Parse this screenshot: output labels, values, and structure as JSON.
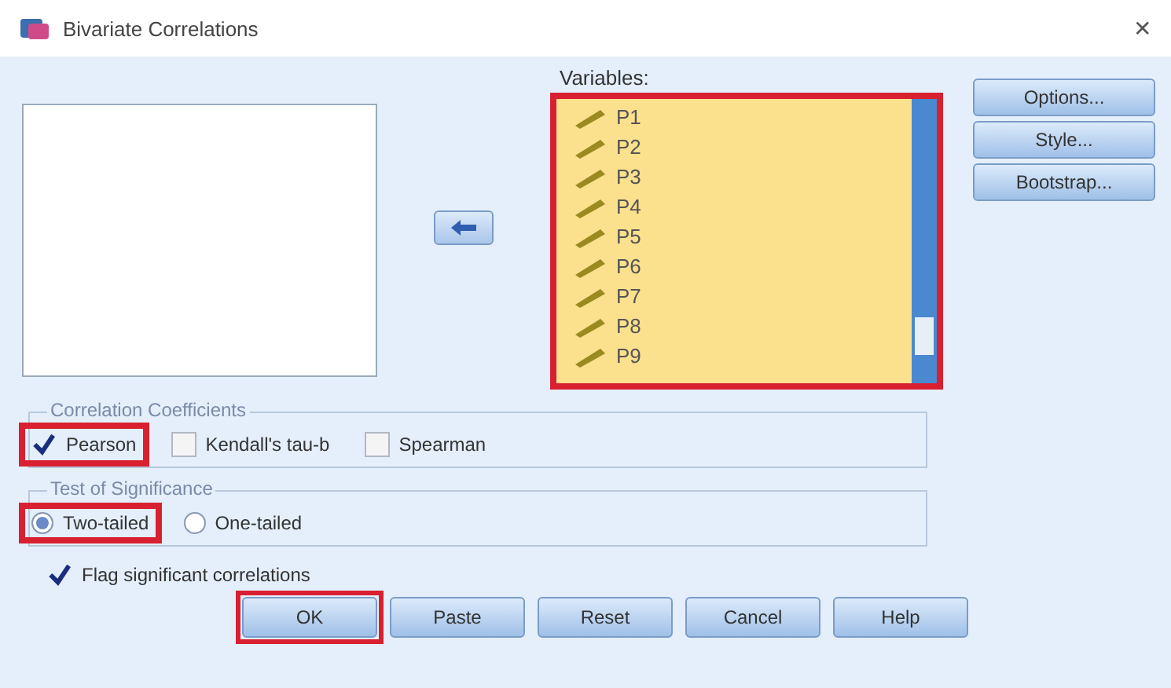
{
  "window": {
    "title": "Bivariate Correlations",
    "close": "✕"
  },
  "variables": {
    "label": "Variables:",
    "highlighted": true,
    "items": [
      {
        "name": "P1"
      },
      {
        "name": "P2"
      },
      {
        "name": "P3"
      },
      {
        "name": "P4"
      },
      {
        "name": "P5"
      },
      {
        "name": "P6"
      },
      {
        "name": "P7"
      },
      {
        "name": "P8"
      },
      {
        "name": "P9"
      }
    ]
  },
  "side_buttons": [
    {
      "label": "Options..."
    },
    {
      "label": "Style..."
    },
    {
      "label": "Bootstrap..."
    }
  ],
  "coefficients": {
    "title": "Correlation Coefficients",
    "options": [
      {
        "label": "Pearson",
        "checked": true,
        "highlighted": true
      },
      {
        "label": "Kendall's tau-b",
        "checked": false,
        "highlighted": false
      },
      {
        "label": "Spearman",
        "checked": false,
        "highlighted": false
      }
    ]
  },
  "significance": {
    "title": "Test of Significance",
    "options": [
      {
        "label": "Two-tailed",
        "selected": true,
        "highlighted": true
      },
      {
        "label": "One-tailed",
        "selected": false,
        "highlighted": false
      }
    ]
  },
  "flag": {
    "label": "Flag significant correlations",
    "checked": true
  },
  "buttons": [
    {
      "label": "OK",
      "highlighted": true
    },
    {
      "label": "Paste",
      "highlighted": false
    },
    {
      "label": "Reset",
      "highlighted": false
    },
    {
      "label": "Cancel",
      "highlighted": false
    },
    {
      "label": "Help",
      "highlighted": false
    }
  ]
}
